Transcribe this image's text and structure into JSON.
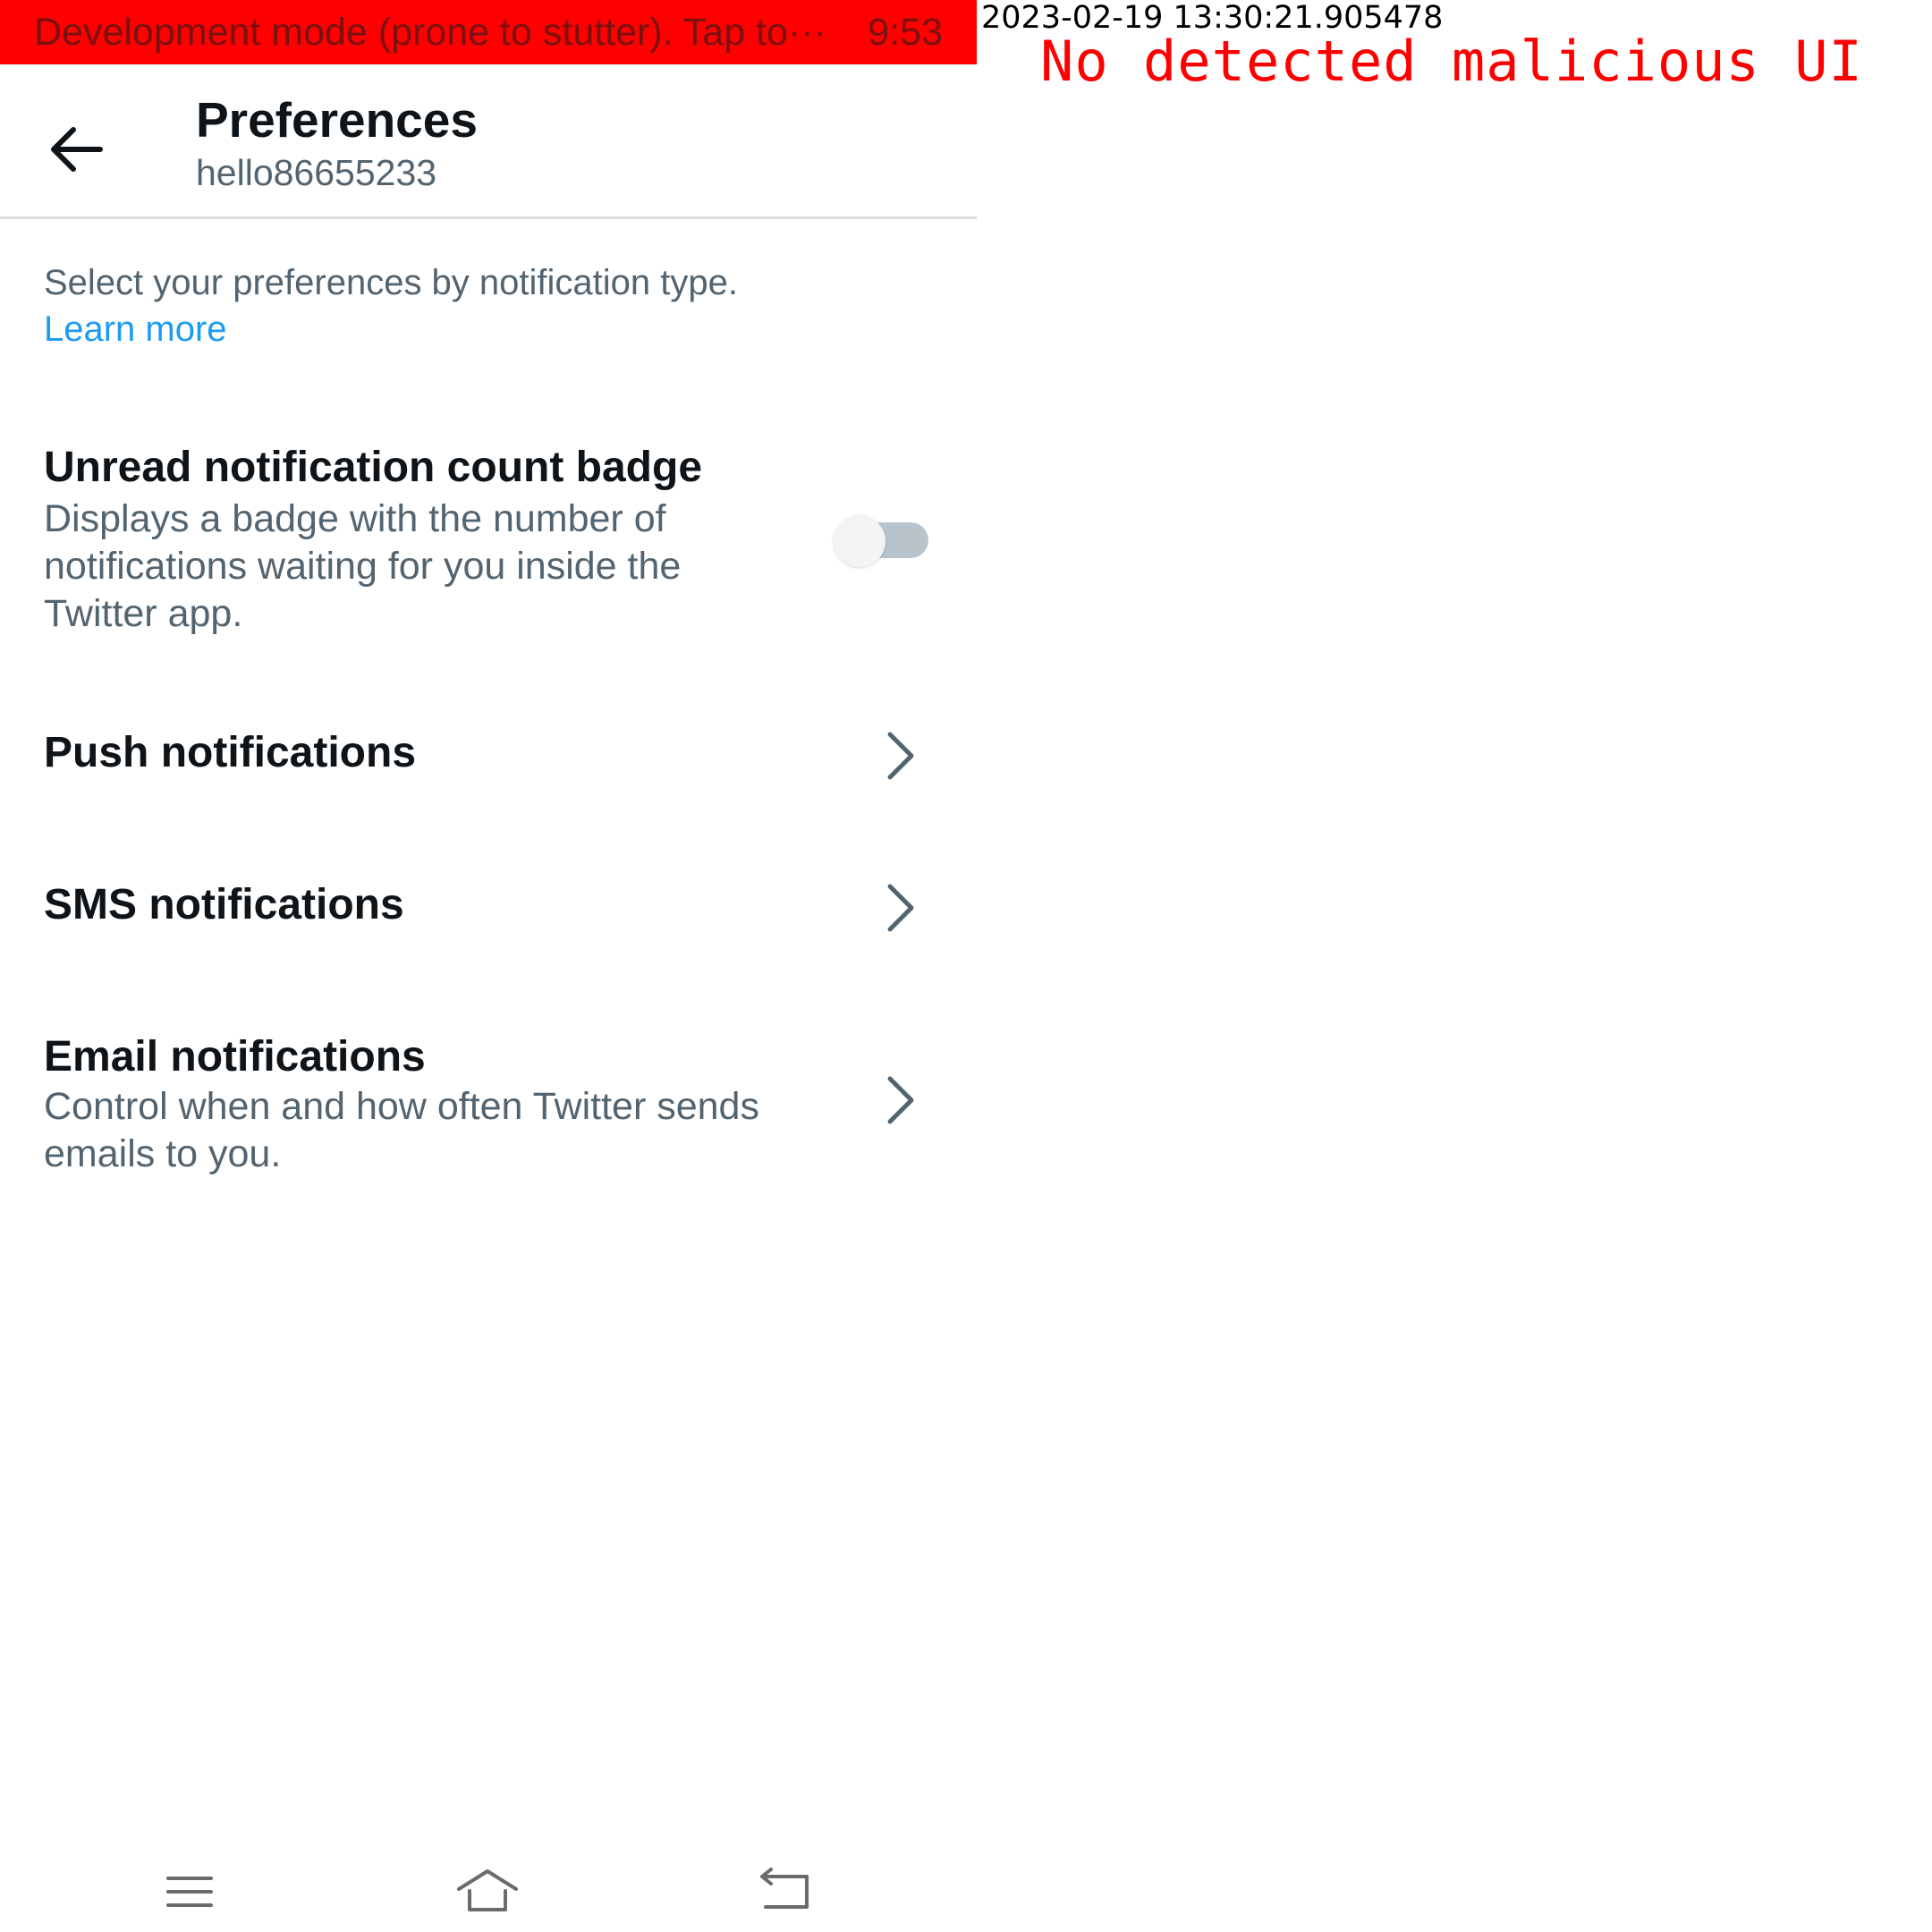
{
  "status_bar": {
    "text": "Development mode (prone to stutter). Tap to···",
    "time": "9:53",
    "color": "#ff0000"
  },
  "header": {
    "back_icon": "arrow-left-icon",
    "title": "Preferences",
    "subtitle": "hello86655233"
  },
  "intro": {
    "text": "Select your preferences by notification type.",
    "link": "Learn more",
    "link_color": "#1d9bf0"
  },
  "badge_setting": {
    "title": "Unread notification count badge",
    "description": "Displays a badge with the number of notifications waiting for you inside the Twitter app.",
    "toggle_on": false
  },
  "push": {
    "title": "Push notifications",
    "icon": "chevron-right-icon"
  },
  "sms": {
    "title": "SMS notifications",
    "icon": "chevron-right-icon"
  },
  "email": {
    "title": "Email notifications",
    "description": "Control when and how often Twitter sends emails to you.",
    "icon": "chevron-right-icon"
  },
  "system_nav": {
    "icons": [
      "menu-icon",
      "home-icon",
      "back-icon"
    ]
  },
  "overlay": {
    "timestamp": "2023-02-19 13:30:21.905478",
    "result": "No detected malicious UI",
    "result_color": "#ff0000"
  }
}
